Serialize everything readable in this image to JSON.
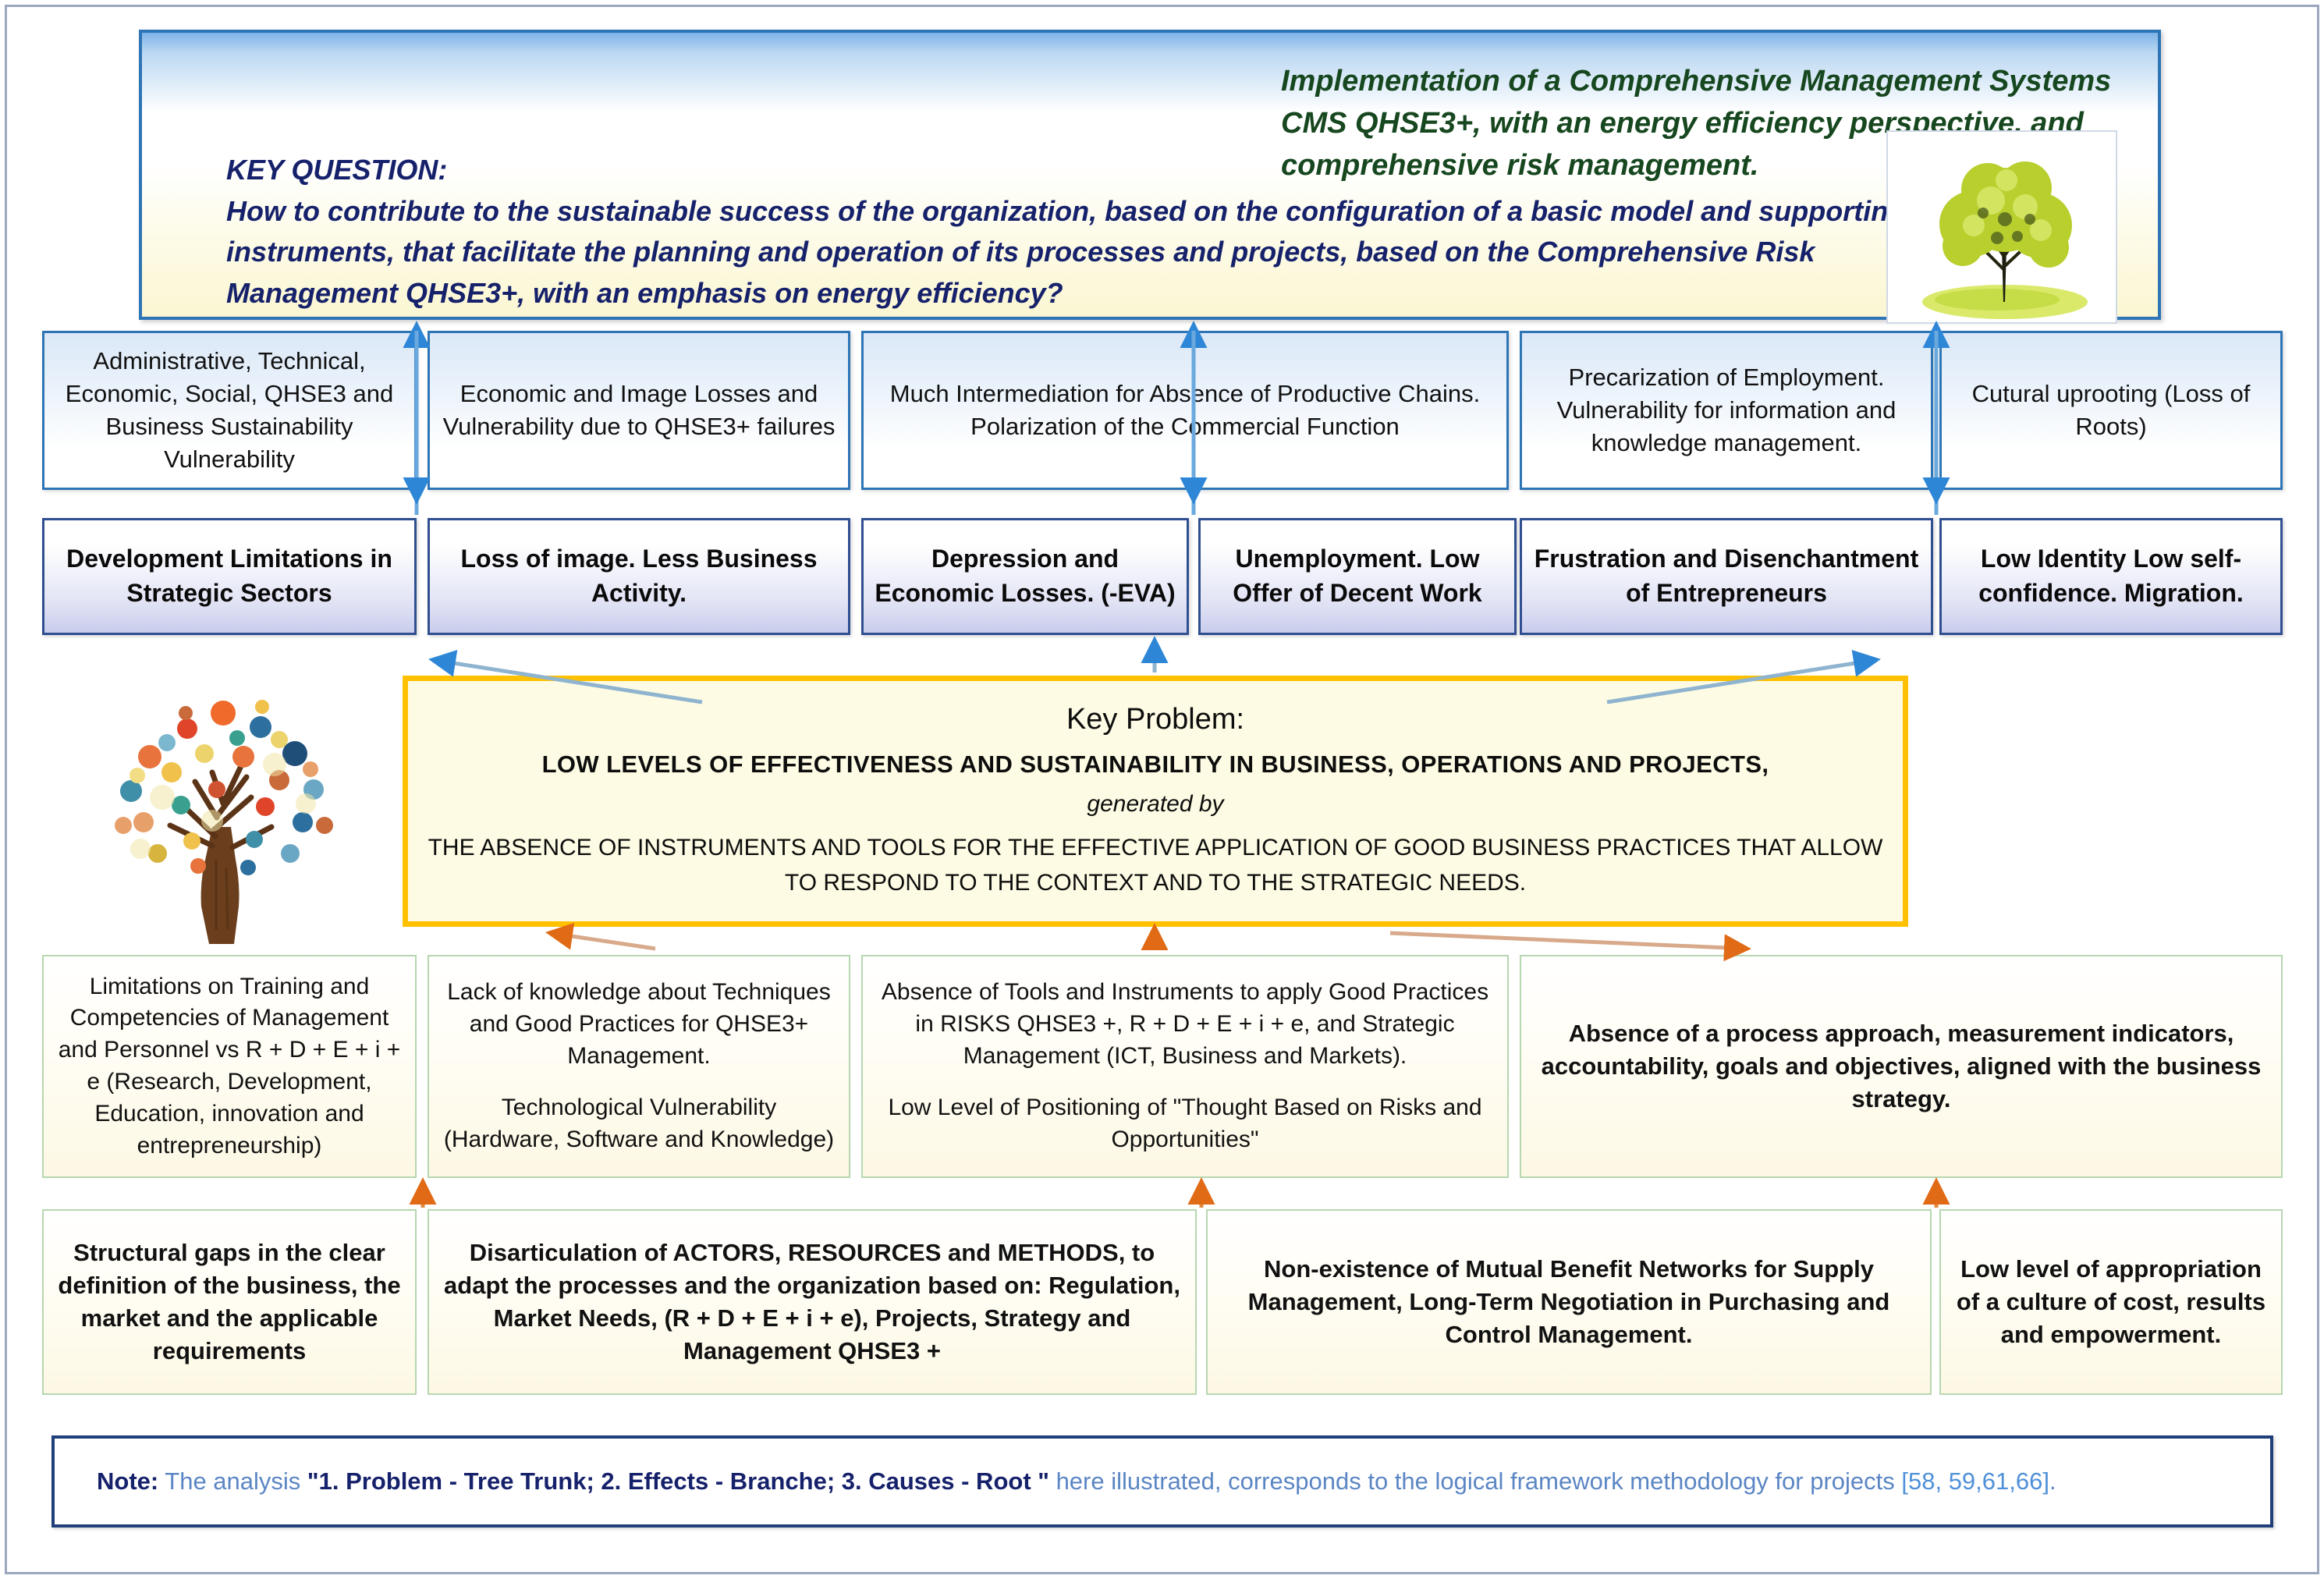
{
  "header": {
    "title": "Implementation of a Comprehensive Management Systems CMS QHSE3+, with an energy efficiency perspective, and comprehensive risk management.",
    "key_question_label": "KEY QUESTION:",
    "key_question_text": "How to contribute to the sustainable success of the organization, based on the configuration of a basic model and supporting instruments, that facilitate the planning and operation of its processes and projects, based on the Comprehensive Risk Management QHSE3+, with an emphasis on energy efficiency?",
    "tree_icon": "green-tree-image"
  },
  "effects_row1": [
    {
      "text": "Administrative, Technical, Economic, Social, QHSE3 and Business Sustainability Vulnerability"
    },
    {
      "text": "Economic and Image Losses and Vulnerability due to QHSE3+ failures"
    },
    {
      "text": "Much Intermediation for Absence of Productive Chains. Polarization of the Commercial Function"
    },
    {
      "text": "Precarization of Employment. Vulnerability for information and knowledge management."
    },
    {
      "text": "Cutural uprooting (Loss of Roots)"
    }
  ],
  "effects_row2": [
    {
      "text": "Development Limitations in Strategic Sectors"
    },
    {
      "text": "Loss of image. Less Business Activity."
    },
    {
      "text": "Depression and Economic Losses. (-EVA)"
    },
    {
      "text": "Unemployment. Low Offer of Decent Work"
    },
    {
      "text": "Frustration and Disenchantment of Entrepreneurs"
    },
    {
      "text": "Low Identity Low self-confidence. Migration."
    }
  ],
  "key_problem": {
    "title": "Key Problem:",
    "line1": "LOW LEVELS OF EFFECTIVENESS AND SUSTAINABILITY IN BUSINESS, OPERATIONS AND PROJECTS,",
    "connector": "generated by",
    "line2": "THE ABSENCE OF INSTRUMENTS AND TOOLS FOR THE EFFECTIVE APPLICATION OF GOOD BUSINESS PRACTICES THAT ALLOW TO RESPOND TO THE CONTEXT AND TO THE STRATEGIC NEEDS."
  },
  "trunk_tree_icon": "handprint-tree-image",
  "causes_row1": [
    {
      "paragraphs": [
        "Limitations on Training and Competencies of Management and Personnel vs R + D + E + i + e (Research, Development, Education, innovation and entrepreneurship)"
      ]
    },
    {
      "paragraphs": [
        "Lack of knowledge about Techniques and Good Practices for QHSE3+ Management.",
        "Technological Vulnerability (Hardware, Software and Knowledge)"
      ]
    },
    {
      "paragraphs": [
        "Absence of Tools and Instruments to apply Good Practices in RISKS QHSE3 +, R + D + E + i + e, and Strategic Management (ICT, Business and Markets).",
        "Low Level of Positioning of \"Thought Based on Risks and Opportunities\""
      ]
    },
    {
      "paragraphs": [
        "Absence of a process approach, measurement indicators, accountability, goals and objectives, aligned with the business strategy."
      ]
    }
  ],
  "causes_row2": [
    {
      "text": "Structural gaps in the clear definition of the business, the market and the applicable requirements"
    },
    {
      "text": "Disarticulation of ACTORS, RESOURCES and METHODS, to adapt the processes and the organization based on: Regulation, Market Needs, (R + D + E + i + e), Projects, Strategy and Management QHSE3 +"
    },
    {
      "text": "Non-existence of Mutual Benefit Networks for Supply Management, Long-Term Negotiation in Purchasing and Control Management."
    },
    {
      "text": "Low level of appropriation of a culture of cost, results and empowerment."
    }
  ],
  "note": {
    "label": "Note:",
    "lead": "The analysis ",
    "quoted": "\"1. Problem - Tree Trunk;  2. Effects - Branche;  3. Causes - Root \"",
    "tail": " here illustrated, corresponds to the logical framework methodology for projects ",
    "citation": "[58, 59,61,66]",
    "period": "."
  },
  "colors": {
    "header_border": "#2e75b6",
    "header_title_text": "#16471f",
    "key_question_text": "#16216b",
    "effect1_border": "#2e75b6",
    "effect2_border": "#2f4f90",
    "key_problem_border": "#ffc000",
    "key_problem_bg": "#fdfbe3",
    "cause_border": "#b6d7b0",
    "cause_bg": "#fdf8e4",
    "note_border": "#1f3f7a",
    "note_text": "#2e5fa3",
    "effect_arrow": "#2e86d6",
    "cause_arrow": "#e06a15"
  }
}
